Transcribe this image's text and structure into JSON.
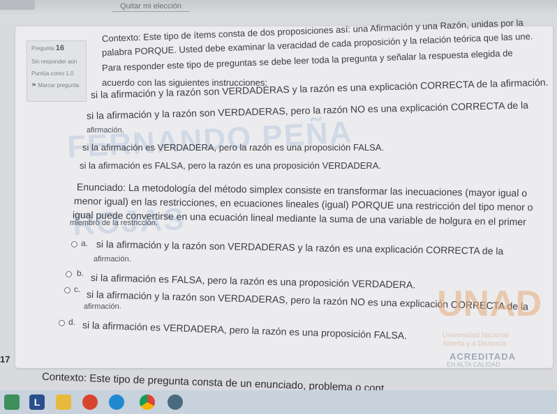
{
  "topbar": {
    "button_label": "Quitar mi elección"
  },
  "question_info": {
    "number_label": "Pregunta",
    "number": "16",
    "status": "Sin responder aún",
    "points": "Puntúa como 1,0",
    "flag": "Marcar pregunta"
  },
  "context": {
    "line1": "Contexto: Este tipo de ítems consta de dos proposiciones así: una Afirmación y una Razón, unidas por la",
    "line2": "palabra PORQUE. Usted debe examinar la veracidad de cada proposición y la relación teórica que las une.",
    "line3": "Para responder este tipo de preguntas se debe leer toda la pregunta y señalar la respuesta elegida de",
    "line4": "acuerdo con las siguientes instrucciones:"
  },
  "instructions": {
    "i1": "si la afirmación y la razón son VERDADERAS y la razón es una explicación CORRECTA de la afirmación.",
    "i2a": "si la afirmación y la razón son VERDADERAS, pero la razón NO es una explicación CORRECTA de la",
    "i2b": "afirmación.",
    "i3": "si la afirmación es VERDADERA, pero la razón es una proposición FALSA.",
    "i4": "si la afirmación es FALSA, pero la razón es una proposición VERDADERA."
  },
  "statement": {
    "line1": "Enunciado: La metodología del método simplex consiste en transformar las inecuaciones (mayor igual o",
    "line2": "menor igual) en las restricciones, en ecuaciones lineales (igual) PORQUE una restricción del tipo menor o",
    "line3": "igual puede convertirse en una ecuación lineal mediante la suma de una variable de holgura en el primer",
    "line4": "miembro de la restricción."
  },
  "options": [
    {
      "letter": "a.",
      "text": "si la afirmación y la razón son VERDADERAS y la razón es una explicación CORRECTA de la",
      "text2": "afirmación."
    },
    {
      "letter": "b.",
      "text": "si la afirmación es FALSA, pero la razón es una proposición VERDADERA."
    },
    {
      "letter": "c.",
      "text": "si la afirmación y la razón son VERDADERAS, pero la razón NO es una explicación CORRECTA de la",
      "text2": "afirmación."
    },
    {
      "letter": "d.",
      "text": "si la afirmación es VERDADERA, pero la razón es una proposición FALSA."
    }
  ],
  "watermark": {
    "line1": "FERNANDO PEÑA",
    "line2": "ROJAS"
  },
  "logo": {
    "word": "UNAD",
    "sub1": "Universidad Nacional",
    "sub2": "Abierta y a Distancia",
    "accredited": "ACREDITADA",
    "quality": "EN ALTA CALIDAD"
  },
  "next_question": {
    "number": "17",
    "context_start": "Contexto: Este tipo de pregunta consta de un enunciado, problema o cont"
  },
  "taskbar": {
    "icons": [
      "slack-icon",
      "l-app-icon",
      "file-explorer-icon",
      "opera-icon",
      "edge-icon",
      "chrome-icon",
      "gamepad-icon"
    ]
  }
}
